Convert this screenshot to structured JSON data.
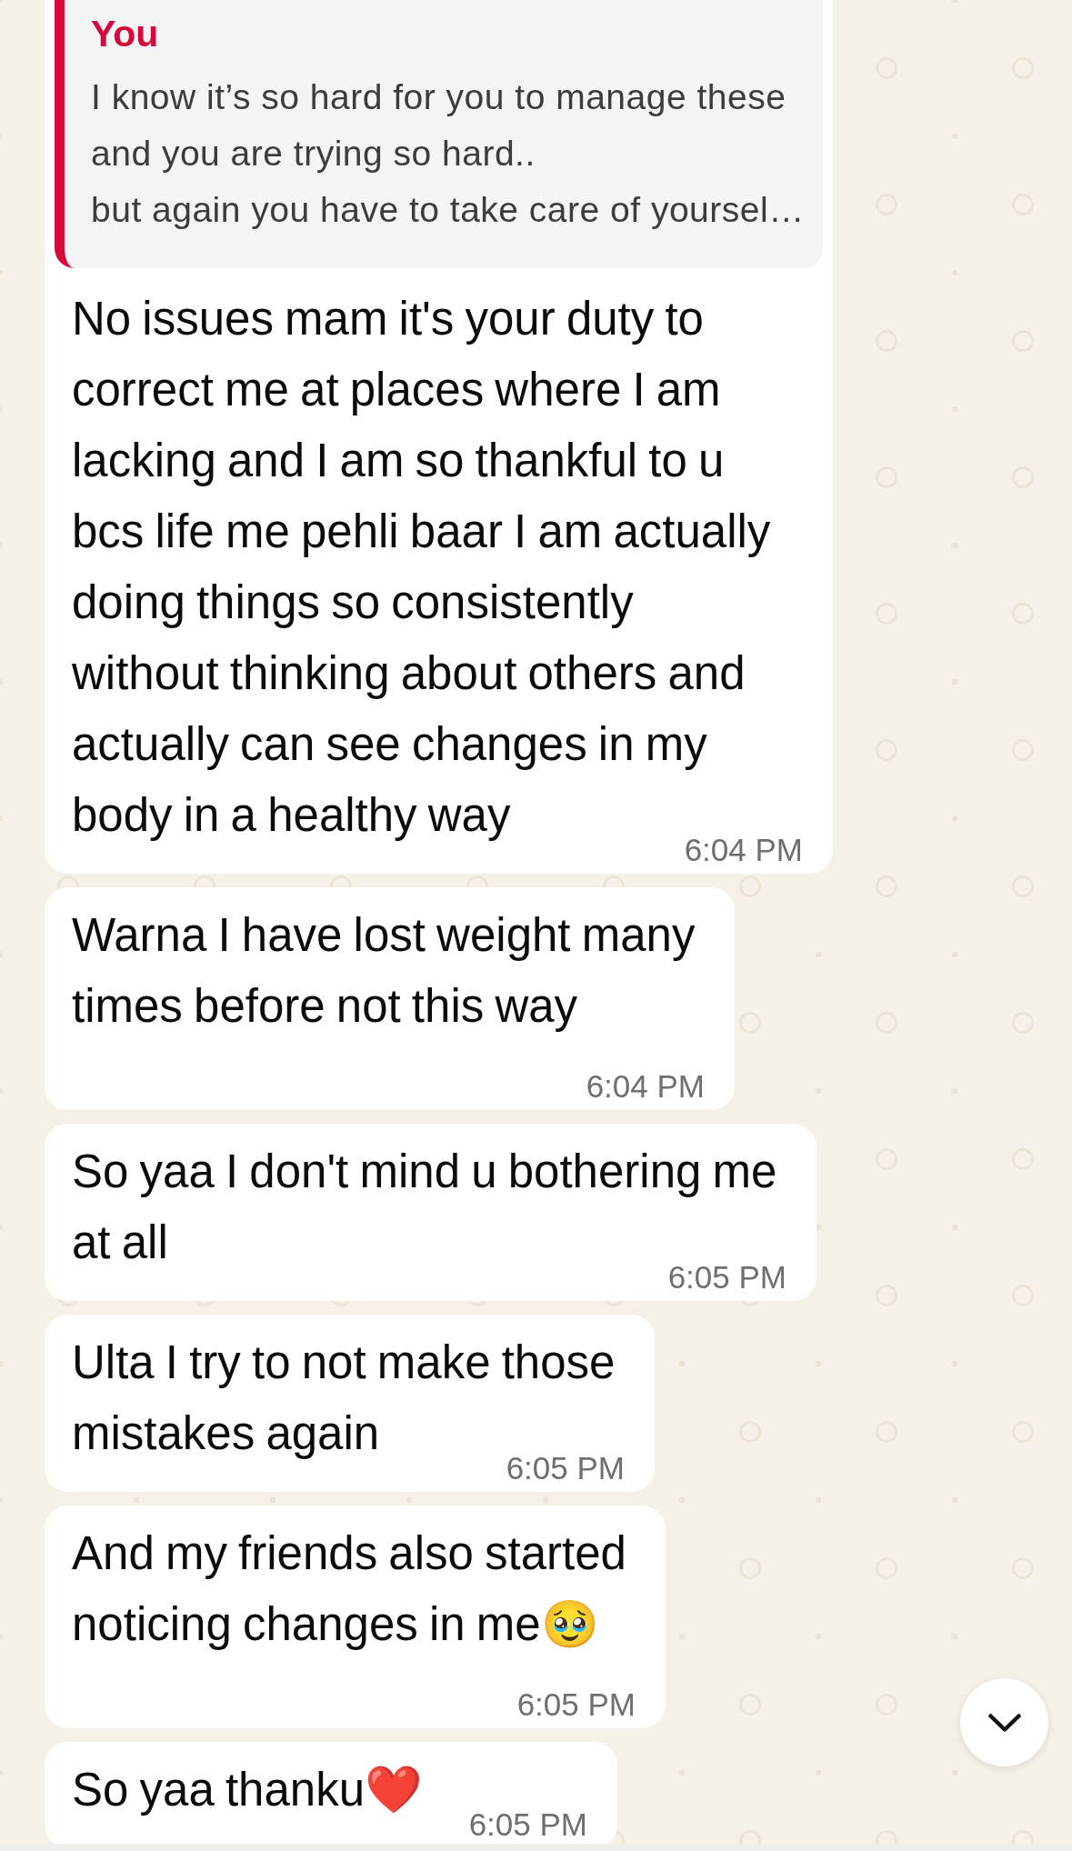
{
  "messages": [
    {
      "quote": {
        "author": "You",
        "text": "I know it’s so hard for you to manage these and you are trying so hard..\nbut again you have to take care of yoursel…"
      },
      "text": "No issues mam it's your duty to correct me at places where I am lacking and I am so thankful to u bcs life me pehli baar I am actually doing things so consistently without thinking about others and actually can see changes in my body in a healthy way",
      "time": "6:04 PM"
    },
    {
      "text": "Warna I have lost weight many times before not this way",
      "time": "6:04 PM"
    },
    {
      "text": "So yaa I don't mind u bothering me at all",
      "time": "6:05 PM"
    },
    {
      "text": "Ulta I try to not make those mistakes again",
      "time": "6:05 PM"
    },
    {
      "text": "And my friends also started noticing changes in me🥹",
      "time": "6:05 PM"
    },
    {
      "text": "So yaa thanku❤️",
      "time": "6:05 PM"
    }
  ]
}
